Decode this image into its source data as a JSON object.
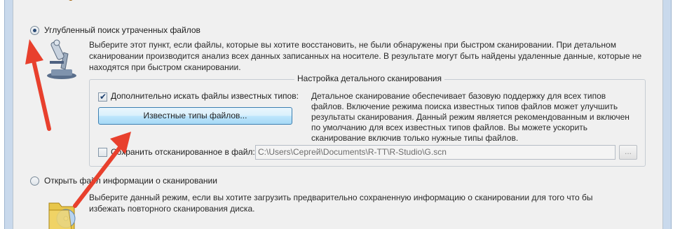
{
  "deep_scan": {
    "label": "Углубленный поиск утраченных файлов",
    "description": "Выберите этот пункт, если файлы, которые вы хотите восстановить, не были обнаружены при быстром сканировании. При детальном сканировании производится анализ всех данных записанных на носителе. В результате могут быть найдены удаленные данные, которые не находятся при быстром сканировании.",
    "selected": true
  },
  "settings_group": {
    "title": "Настройка детального сканирования",
    "known_types_checkbox_label": "Дополнительно искать файлы известных типов:",
    "known_types_checked": true,
    "known_types_button": "Известные типы файлов...",
    "info_text": "Детальное сканирование обеспечивает базовую поддержку для всех типов файлов. Включение режима поиска известных типов файлов может улучшить результаты сканирования. Данный режим является рекомендованным и включен по умолчанию для всех известных типов файлов. Вы можете ускорить сканирование включив только нужные типы файлов.",
    "save_checkbox_label": "Сохранить отсканированное в файл:",
    "save_checked": false,
    "save_path": "C:\\Users\\Сергей\\Documents\\R-TT\\R-Studio\\G.scn",
    "browse_label": "..."
  },
  "open_scan": {
    "label": "Открыть файл информации о сканировании",
    "description": "Выберите данный режим, если вы хотите загрузить предварительно сохраненную информацию о сканировании для того что бы избежать повторного сканирования диска.",
    "selected": false
  },
  "icons": {
    "microscope": "microscope-icon",
    "folder_disc": "folder-disc-icon",
    "search_tool": "magnifier-icon"
  },
  "colors": {
    "annotation_arrow": "#e8402d",
    "button_border": "#3c7fb1",
    "frame": "#c9d9ec"
  }
}
